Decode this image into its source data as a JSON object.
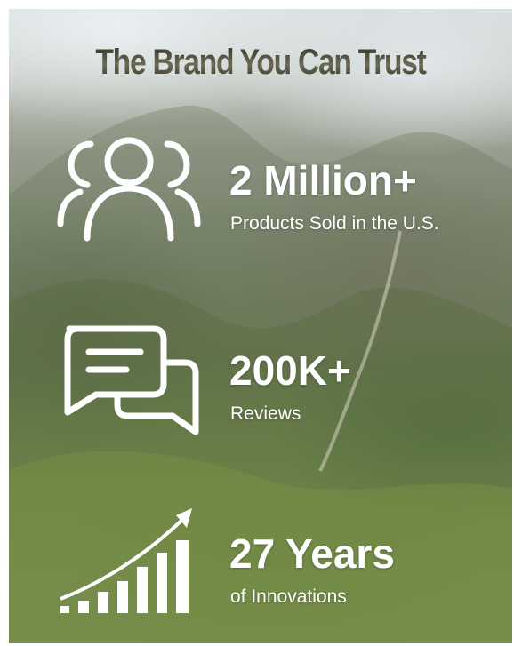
{
  "title": "The Brand You Can Trust",
  "stats": [
    {
      "value": "2 Million+",
      "label": "Products Sold in the U.S.",
      "icon": "users-group-icon"
    },
    {
      "value": "200K+",
      "label": "Reviews",
      "icon": "chat-bubbles-icon"
    },
    {
      "value": "27 Years",
      "label": "of Innovations",
      "icon": "growth-chart-icon"
    }
  ],
  "colors": {
    "title": "#3b3b2c",
    "text": "#ffffff",
    "background_top": "#d6dcdc",
    "background_bottom": "#8ea556"
  }
}
